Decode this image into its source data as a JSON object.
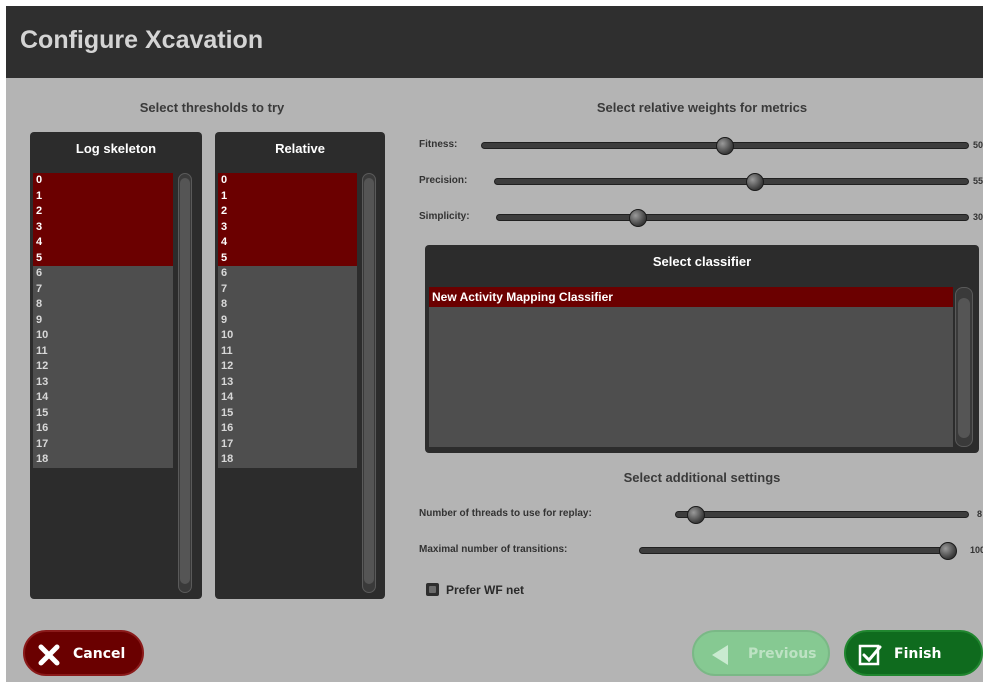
{
  "window": {
    "title": "Configure Xcavation"
  },
  "thresholds": {
    "heading": "Select thresholds to try",
    "log_skeleton": {
      "header": "Log skeleton",
      "items": [
        "0",
        "1",
        "2",
        "3",
        "4",
        "5",
        "6",
        "7",
        "8",
        "9",
        "10",
        "11",
        "12",
        "13",
        "14",
        "15",
        "16",
        "17",
        "18"
      ],
      "selected_count": 6
    },
    "relative": {
      "header": "Relative",
      "items": [
        "0",
        "1",
        "2",
        "3",
        "4",
        "5",
        "6",
        "7",
        "8",
        "9",
        "10",
        "11",
        "12",
        "13",
        "14",
        "15",
        "16",
        "17",
        "18"
      ],
      "selected_count": 6
    }
  },
  "weights": {
    "heading": "Select relative weights for metrics",
    "sliders": [
      {
        "label": "Fitness:",
        "value_text": "50",
        "fraction": 0.5
      },
      {
        "label": "Precision:",
        "value_text": "55",
        "fraction": 0.55
      },
      {
        "label": "Simplicity:",
        "value_text": "30",
        "fraction": 0.3
      }
    ]
  },
  "classifier": {
    "header": "Select classifier",
    "items": [
      "New Activity Mapping Classifier"
    ],
    "selected": "New Activity Mapping Classifier"
  },
  "additional": {
    "heading": "Select additional settings",
    "threads": {
      "label": "Number of threads to use for replay:",
      "value_text": "8",
      "fraction": 0.07
    },
    "transitions": {
      "label": "Maximal number of transitions:",
      "value_text": "100",
      "fraction": 1.0
    },
    "prefer_wf": {
      "label": "Prefer WF net",
      "checked": false
    }
  },
  "buttons": {
    "cancel": "Cancel",
    "previous": "Previous",
    "finish": "Finish"
  },
  "colors": {
    "selected_row": "#6b0000",
    "title_bar": "#2f2f2f",
    "finish_green": "#0f6b1e",
    "cancel_red": "#6a0000"
  }
}
